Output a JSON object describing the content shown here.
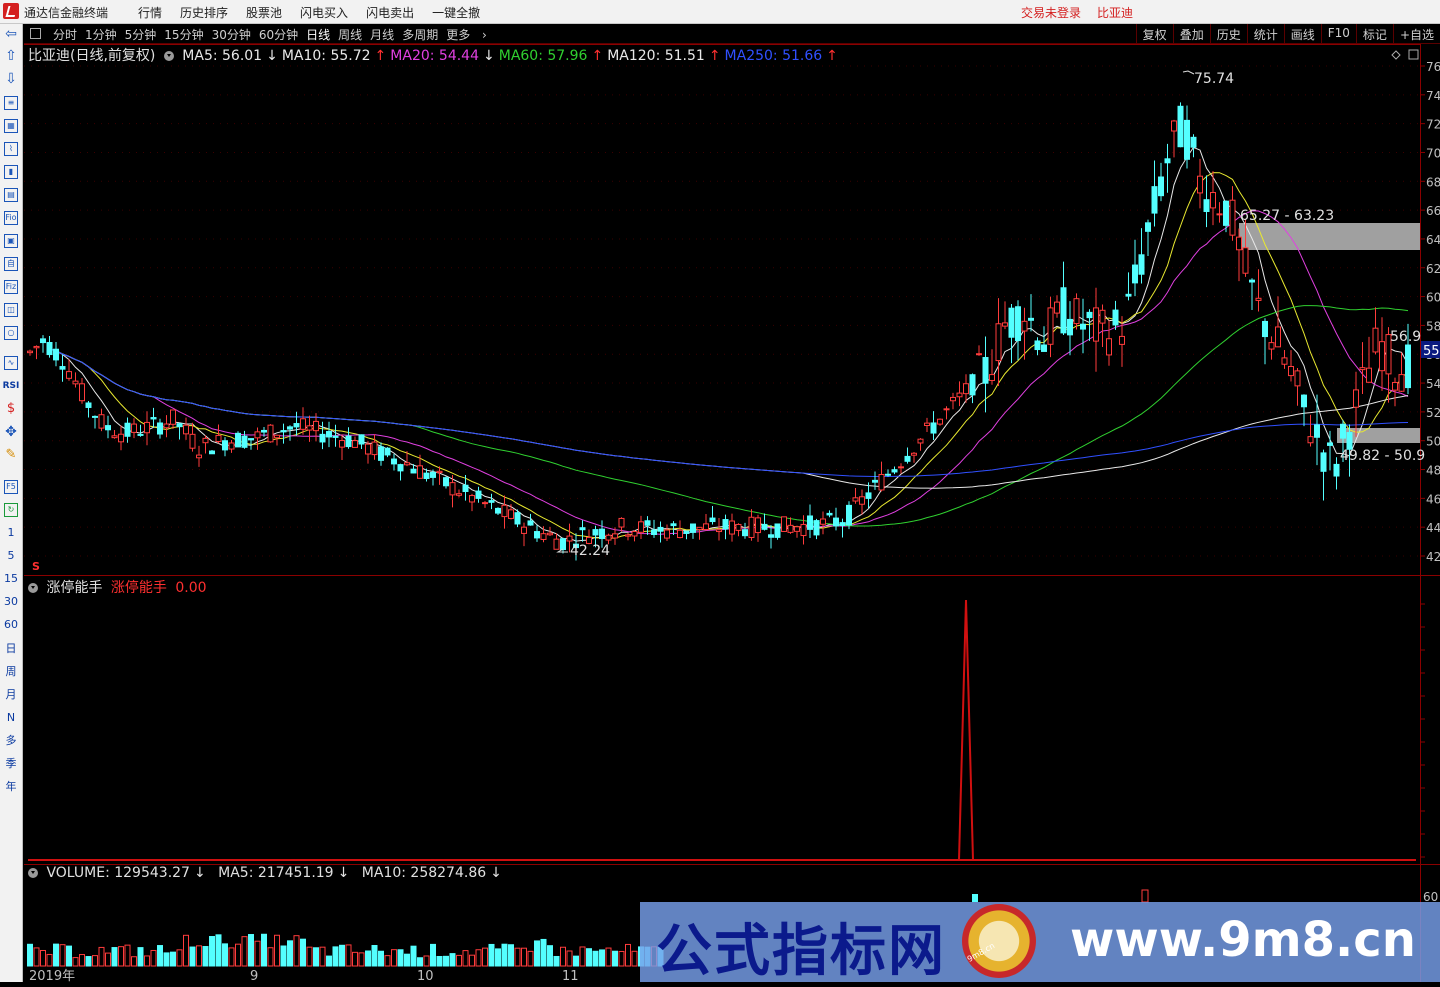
{
  "app": {
    "title": "通达信金融终端",
    "menu": [
      "行情",
      "历史排序",
      "股票池",
      "闪电买入",
      "闪电卖出",
      "一键全撤"
    ],
    "login_status": "交易未登录",
    "current_stock": "比亚迪"
  },
  "left_toolbar": {
    "period_shortcuts": [
      "1",
      "5",
      "15",
      "30",
      "60",
      "日",
      "周",
      "月",
      "N",
      "多",
      "季",
      "年"
    ],
    "rsi_label": "RSI",
    "f5_label": "F5",
    "fio_label": "Fio",
    "fiz_label": "Fiz"
  },
  "period_bar": {
    "periods": [
      "分时",
      "1分钟",
      "5分钟",
      "15分钟",
      "30分钟",
      "60分钟",
      "日线",
      "周线",
      "月线",
      "多周期",
      "更多"
    ],
    "active_period": "日线",
    "tools": [
      "复权",
      "叠加",
      "历史",
      "统计",
      "画线",
      "F10",
      "标记",
      "+自选"
    ]
  },
  "main_chart": {
    "stock_title": "比亚迪(日线,前复权)",
    "indicators": [
      {
        "label": "MA5: 56.01",
        "arrow": "↓",
        "color": "#e8e8e8"
      },
      {
        "label": "MA10: 55.72",
        "arrow": "↑",
        "color": "#e8e8e8"
      },
      {
        "label": "MA20: 54.44",
        "arrow": "↓",
        "color": "#e040e0"
      },
      {
        "label": "MA60: 57.96",
        "arrow": "↑",
        "color": "#30d030"
      },
      {
        "label": "MA120: 51.51",
        "arrow": "↑",
        "color": "#e8e8e8"
      },
      {
        "label": "MA250: 51.66",
        "arrow": "↑",
        "color": "#3050ff"
      }
    ],
    "high_label": "75.74",
    "low_label": "42.24",
    "zone_upper_label": "65.27 - 63.23",
    "zone_lower_label": "49.82 - 50.9",
    "ma_label_right": "56.9",
    "last_price_tag": "55",
    "s_marker": "S"
  },
  "chart_data": [
    {
      "type": "candlestick",
      "title": "比亚迪(日线,前复权)",
      "ylim": [
        41,
        77
      ],
      "y_ticks": [
        "76",
        "74",
        "72",
        "70",
        "68",
        "66",
        "64",
        "62",
        "60",
        "58",
        "56",
        "54",
        "52",
        "50",
        "48",
        "46",
        "44",
        "42"
      ],
      "annotations": {
        "high": 75.74,
        "low": 42.24,
        "zone_upper": [
          65.27,
          63.23
        ],
        "zone_lower": [
          49.82,
          50.9
        ]
      },
      "series": [
        {
          "name": "MA5",
          "value": 56.01
        },
        {
          "name": "MA10",
          "value": 55.72
        },
        {
          "name": "MA20",
          "value": 54.44
        },
        {
          "name": "MA60",
          "value": 57.96
        },
        {
          "name": "MA120",
          "value": 51.51
        },
        {
          "name": "MA250",
          "value": 51.66
        }
      ]
    },
    {
      "type": "line",
      "title": "涨停能手",
      "series": [
        {
          "name": "涨停能手",
          "value": 0.0
        }
      ]
    },
    {
      "type": "bar",
      "title": "VOLUME",
      "series": [
        {
          "name": "VOLUME",
          "value": 129543.27
        },
        {
          "name": "MA5",
          "value": 217451.19
        },
        {
          "name": "MA10",
          "value": 258274.86
        }
      ],
      "x_tick_labels": [
        "2019年",
        "9",
        "10",
        "11"
      ],
      "y_tick_label": "60"
    }
  ],
  "indicator_panel": {
    "name": "涨停能手",
    "series_label": "涨停能手",
    "value": "0.00"
  },
  "volume_panel": {
    "volume_label": "VOLUME: 129543.27",
    "volume_arrow": "↓",
    "ma5_label": "MA5: 217451.19",
    "ma5_arrow": "↓",
    "ma10_label": "MA10: 258274.86",
    "ma10_arrow": "↓",
    "x_labels": [
      "2019年",
      "9",
      "10",
      "11"
    ],
    "y_label": "60"
  },
  "watermark": {
    "brand": "公式指标网",
    "url": "www.9m8.cn",
    "badge_text": "9m8.cn"
  },
  "colors": {
    "up": "#ff3c3c",
    "down": "#54ffff",
    "background": "#000000",
    "grid_red": "#8b0000",
    "zone": "#a0a0a0"
  }
}
